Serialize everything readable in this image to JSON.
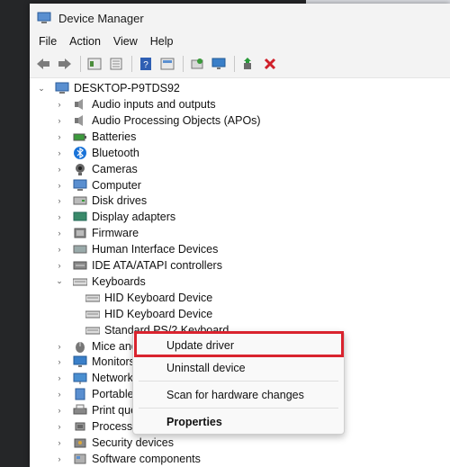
{
  "window": {
    "title": "Device Manager"
  },
  "menu": [
    "File",
    "Action",
    "View",
    "Help"
  ],
  "toolbar": {
    "icons": [
      "back-arrow-icon",
      "forward-arrow-icon",
      "properties-icon",
      "update-list-icon",
      "help-icon",
      "device-view-icon",
      "add-legacy-hardware-icon",
      "monitor-icon",
      "enable-device-icon",
      "uninstall-device-icon"
    ],
    "colors": {
      "delete_red": "#d0202a",
      "green": "#2a9a3a"
    }
  },
  "tree": {
    "root": "DESKTOP-P9TDS92",
    "items": [
      {
        "label": "Audio inputs and outputs",
        "icon": "speaker-icon"
      },
      {
        "label": "Audio Processing Objects (APOs)",
        "icon": "speaker-icon"
      },
      {
        "label": "Batteries",
        "icon": "battery-icon"
      },
      {
        "label": "Bluetooth",
        "icon": "bluetooth-icon"
      },
      {
        "label": "Cameras",
        "icon": "camera-icon"
      },
      {
        "label": "Computer",
        "icon": "computer-icon"
      },
      {
        "label": "Disk drives",
        "icon": "disk-icon"
      },
      {
        "label": "Display adapters",
        "icon": "display-icon"
      },
      {
        "label": "Firmware",
        "icon": "firmware-icon"
      },
      {
        "label": "Human Interface Devices",
        "icon": "hid-icon"
      },
      {
        "label": "IDE ATA/ATAPI controllers",
        "icon": "ide-icon"
      },
      {
        "label": "Keyboards",
        "icon": "keyboard-icon",
        "expanded": true
      },
      {
        "label": "HID Keyboard Device",
        "icon": "keyboard-icon",
        "child": true
      },
      {
        "label": "HID Keyboard Device",
        "icon": "keyboard-icon",
        "child": true
      },
      {
        "label": "Standard PS/2 Keyboard",
        "icon": "keyboard-icon",
        "child": true
      },
      {
        "label": "Mice and",
        "icon": "mouse-icon"
      },
      {
        "label": "Monitors",
        "icon": "monitor-icon"
      },
      {
        "label": "Network a",
        "icon": "network-icon"
      },
      {
        "label": "Portable D",
        "icon": "portable-device-icon"
      },
      {
        "label": "Print queu",
        "icon": "printer-icon"
      },
      {
        "label": "Processor",
        "icon": "processor-icon"
      },
      {
        "label": "Security devices",
        "icon": "security-icon"
      },
      {
        "label": "Software components",
        "icon": "software-icon"
      }
    ]
  },
  "context_menu": {
    "items": [
      "Update driver",
      "Uninstall device",
      "Scan for hardware changes",
      "Properties"
    ],
    "highlight_color": "#d9232e"
  }
}
